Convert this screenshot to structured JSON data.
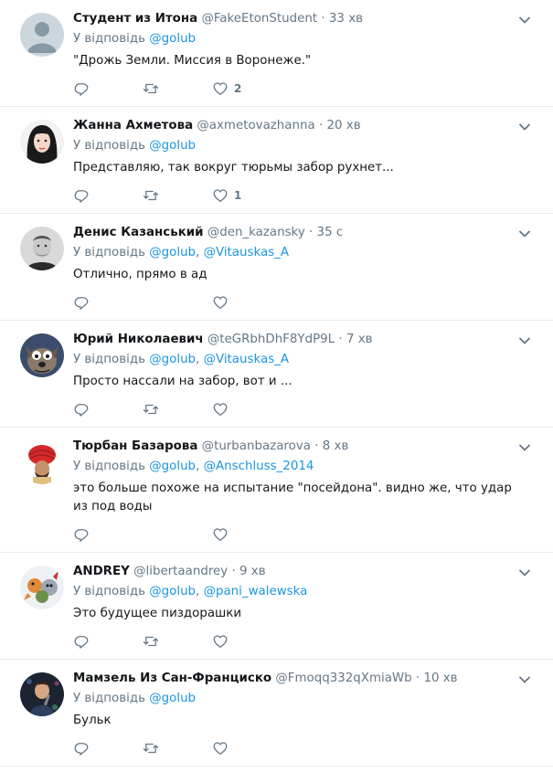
{
  "reply_prefix": "У відповідь",
  "tweets": [
    {
      "name": "Студент из Итона",
      "handle": "@FakeEtonStudent",
      "time": "33 хв",
      "mentions": [
        "@golub"
      ],
      "text": "\"Дрожь Земли. Миссия в Воронеже.\"",
      "likes": "2",
      "retweet_icon": true,
      "avatar": "default-avatar"
    },
    {
      "name": "Жанна Ахметова",
      "handle": "@axmetovazhanna",
      "time": "20 хв",
      "mentions": [
        "@golub"
      ],
      "text": "Представляю, так вокруг тюрьмы забор рухнет...",
      "likes": "1",
      "retweet_icon": true,
      "avatar": "woman-avatar"
    },
    {
      "name": "Денис Казанський",
      "handle": "@den_kazansky",
      "time": "35 с",
      "mentions": [
        "@golub",
        "@Vitauskas_A"
      ],
      "text": "Отлично, прямо в ад",
      "likes": "",
      "retweet_icon": false,
      "avatar": "man-avatar"
    },
    {
      "name": "Юрий Николаевич",
      "handle": "@teGRbhDhF8YdP9L",
      "time": "7 хв",
      "mentions": [
        "@golub",
        "@Vitauskas_A"
      ],
      "text": "Просто нассали на забор, вот и ...",
      "likes": "",
      "retweet_icon": true,
      "avatar": "cartoon-dog-avatar"
    },
    {
      "name": "Тюрбан Базарова",
      "handle": "@turbanbazarova",
      "time": "8 хв",
      "mentions": [
        "@golub",
        "@Anschluss_2014"
      ],
      "text": "это больше похоже на испытание \"посейдона\". видно же, что удар из под воды",
      "likes": "",
      "retweet_icon": false,
      "avatar": "turban-avatar"
    },
    {
      "name": "ANDREY",
      "handle": "@libertaandrey",
      "time": "9 хв",
      "mentions": [
        "@golub",
        "@pani_walewska"
      ],
      "text": "Это будущее пиздорашки",
      "likes": "",
      "retweet_icon": true,
      "avatar": "cartoon-animals-avatar"
    },
    {
      "name": "Мамзель Из Сан-Франциско",
      "handle": "@Fmoqq332qXmiaWb",
      "time": "10 хв",
      "mentions": [
        "@golub"
      ],
      "text": "Бульк",
      "likes": "",
      "retweet_icon": true,
      "avatar": "singer-avatar"
    }
  ],
  "colors": {
    "link": "#1b95e0",
    "secondary": "#657786",
    "divider": "#e6ecf0"
  }
}
